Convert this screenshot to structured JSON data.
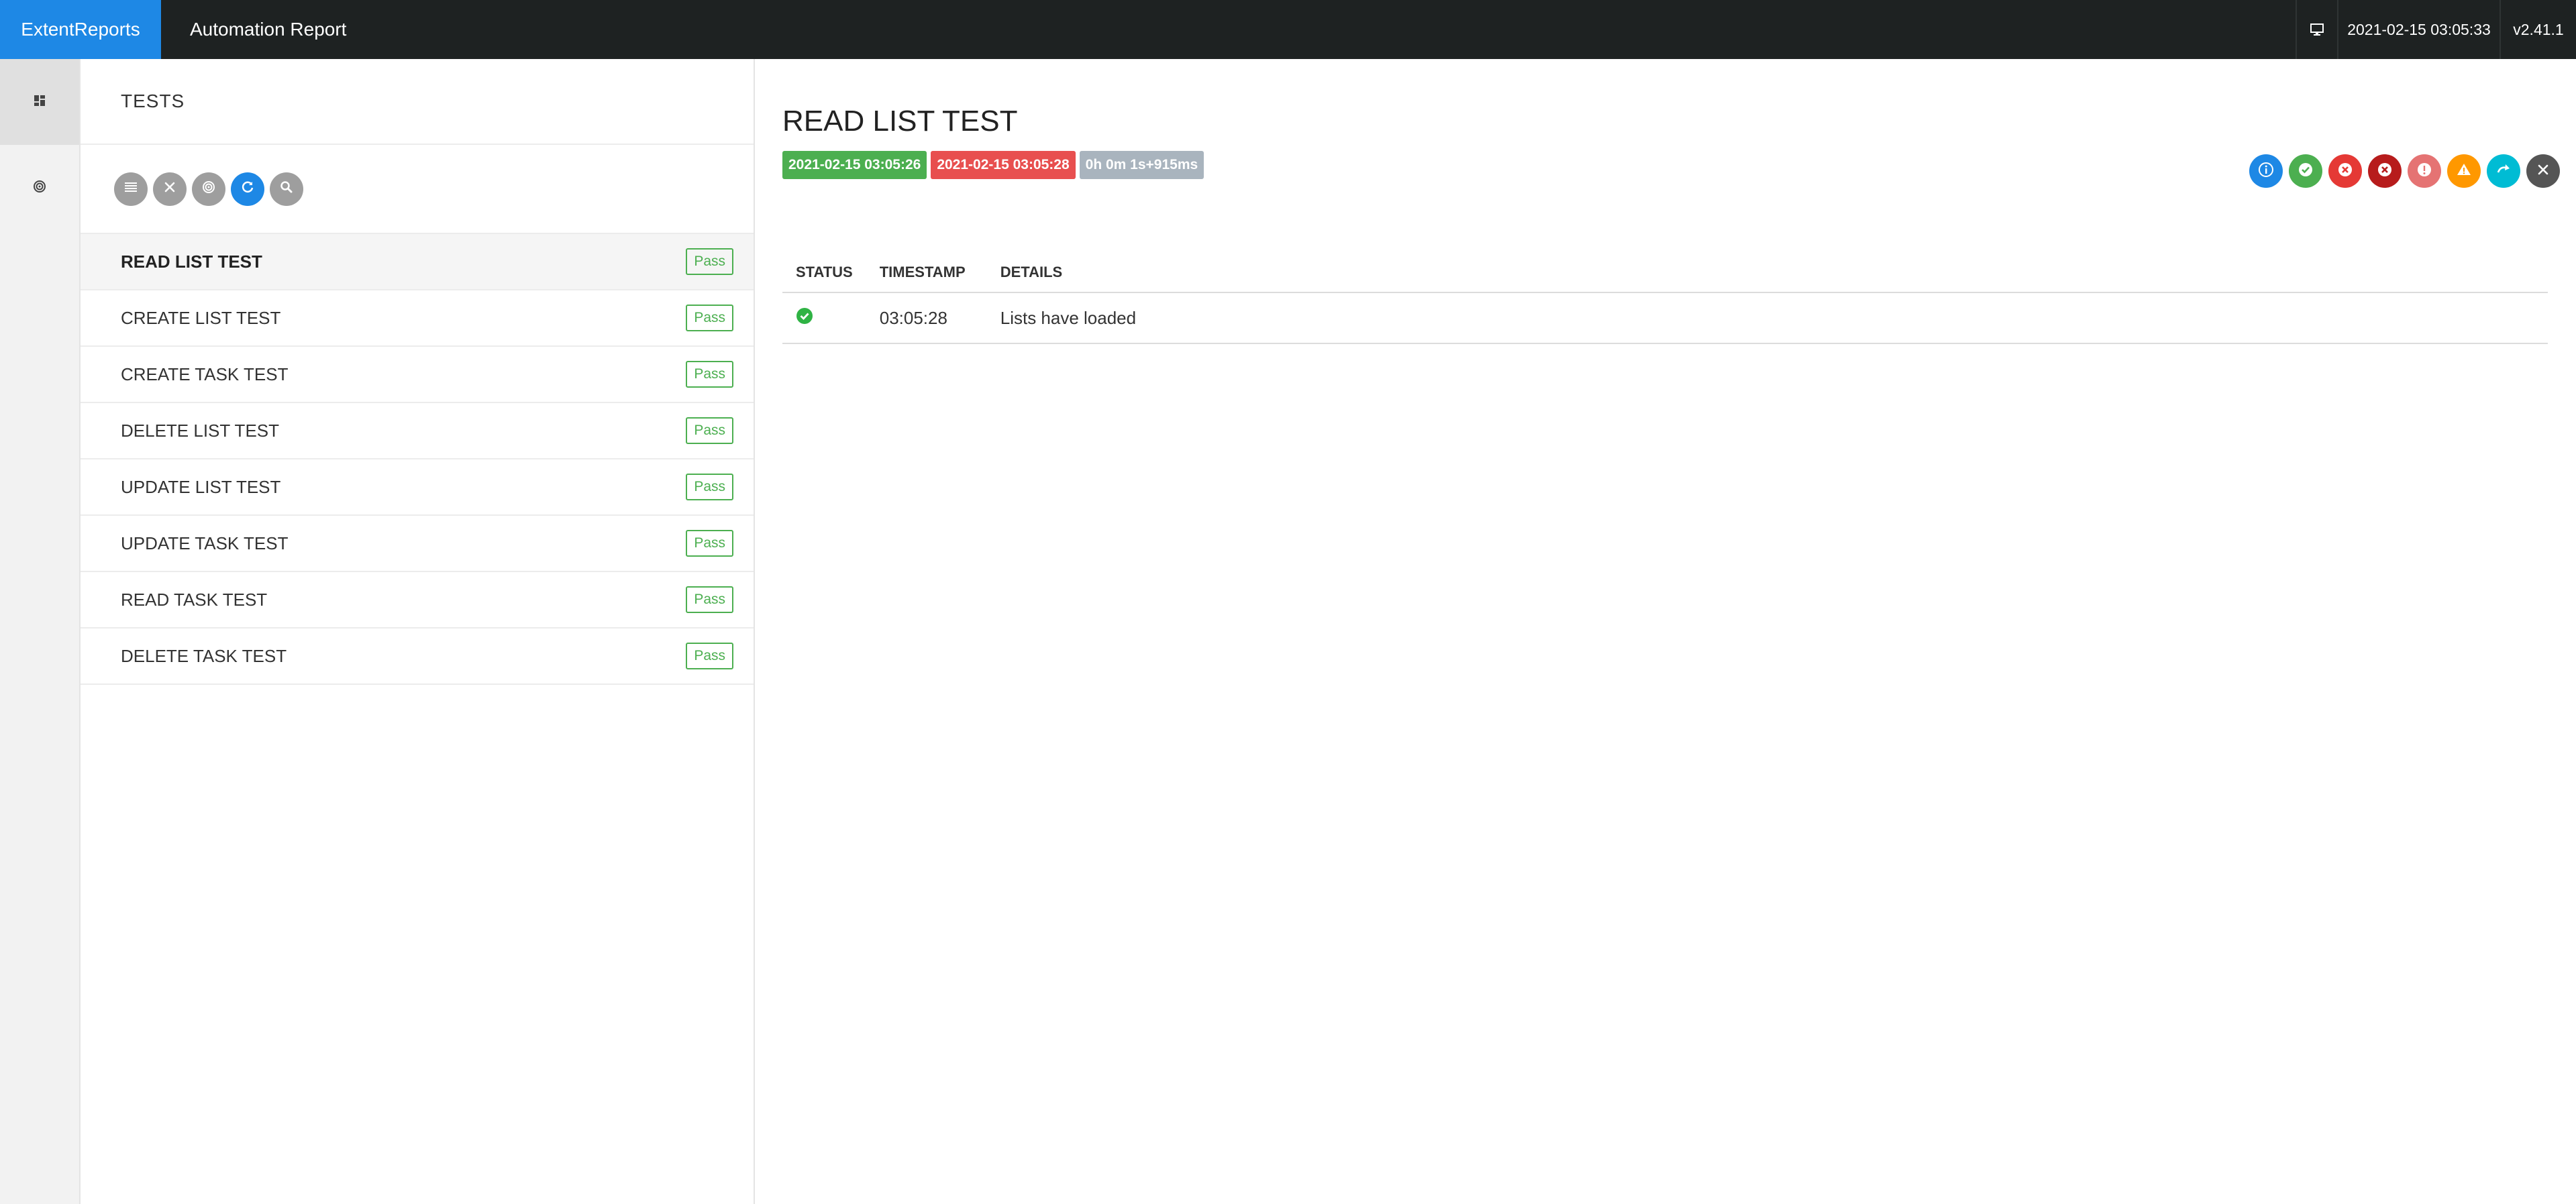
{
  "navbar": {
    "brand": "ExtentReports",
    "report_name": "Automation Report",
    "datetime": "2021-02-15 03:05:33",
    "version": "v2.41.1",
    "monitor_icon": "monitor-icon"
  },
  "rail": {
    "items": [
      {
        "icon": "dashboard-icon",
        "active": true
      },
      {
        "icon": "target-icon",
        "active": false
      }
    ]
  },
  "tests_panel": {
    "header": "TESTS",
    "toolbar_icons": [
      "list-icon",
      "close-icon",
      "target-icon",
      "refresh-icon",
      "search-icon"
    ],
    "tests": [
      {
        "name": "READ LIST TEST",
        "status": "Pass"
      },
      {
        "name": "CREATE LIST TEST",
        "status": "Pass"
      },
      {
        "name": "CREATE TASK TEST",
        "status": "Pass"
      },
      {
        "name": "DELETE LIST TEST",
        "status": "Pass"
      },
      {
        "name": "UPDATE LIST TEST",
        "status": "Pass"
      },
      {
        "name": "UPDATE TASK TEST",
        "status": "Pass"
      },
      {
        "name": "READ TASK TEST",
        "status": "Pass"
      },
      {
        "name": "DELETE TASK TEST",
        "status": "Pass"
      }
    ]
  },
  "detail": {
    "title": "READ LIST TEST",
    "start_time": "2021-02-15 03:05:26",
    "end_time": "2021-02-15 03:05:28",
    "duration": "0h 0m 1s+915ms",
    "status_filters": [
      {
        "icon": "info-icon",
        "color": "#1e88e5"
      },
      {
        "icon": "pass-icon",
        "color": "#4caf50"
      },
      {
        "icon": "fail-icon",
        "color": "#e53935"
      },
      {
        "icon": "fatal-icon",
        "color": "#b71c1c"
      },
      {
        "icon": "error-icon",
        "color": "#e57373"
      },
      {
        "icon": "warning-icon",
        "color": "#ff9800"
      },
      {
        "icon": "skip-icon",
        "color": "#00bcd4"
      },
      {
        "icon": "clear-icon",
        "color": "#555555"
      }
    ],
    "log": {
      "columns": [
        "STATUS",
        "TIMESTAMP",
        "DETAILS"
      ],
      "rows": [
        {
          "status_icon": "pass-icon",
          "timestamp": "03:05:28",
          "details": "Lists have loaded"
        }
      ]
    }
  },
  "colors": {
    "navbar": "#1e2222",
    "brand": "#1e88e5",
    "pass": "#4caf50",
    "fail": "#e84f4f"
  }
}
